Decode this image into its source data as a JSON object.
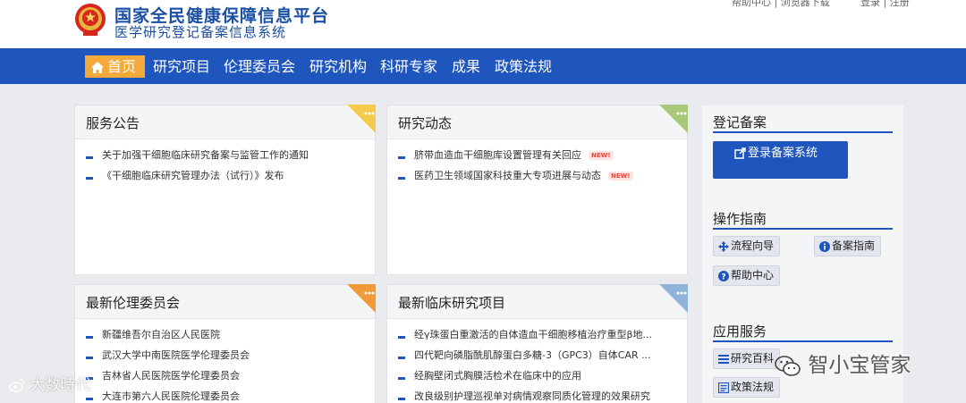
{
  "header": {
    "title_main": "国家全民健康保障信息平台",
    "title_sub": "医学研究登记备案信息系统",
    "top_link_left": "帮助中心 | 浏览器下载",
    "top_link_right": "登录 | 注册"
  },
  "nav": {
    "home": "首页",
    "items": [
      "研究项目",
      "伦理委员会",
      "研究机构",
      "科研专家",
      "成果",
      "政策法规"
    ]
  },
  "panels": {
    "notice": {
      "title": "服务公告",
      "items": [
        "关于加强干细胞临床研究备案与监管工作的通知",
        "《干细胞临床研究管理办法（试行）》发布"
      ]
    },
    "news": {
      "title": "研究动态",
      "items": [
        "脐带血造血干细胞库设置管理有关回应",
        "医药卫生领域国家科技重大专项进展与动态"
      ],
      "badge": "NEW!"
    },
    "ethics": {
      "title": "最新伦理委员会",
      "items": [
        "新疆维吾尔自治区人民医院",
        "武汉大学中南医院医学伦理委员会",
        "吉林省人民医院医学伦理委员会",
        "大连市第六人民医院伦理委员会"
      ]
    },
    "projects": {
      "title": "最新临床研究项目",
      "items": [
        "经γ珠蛋白重激活的自体造血干细胞移植治疗重型β地...",
        "四代靶向磷脂酰肌醇蛋白多糖-3（GPC3）自体CAR ...",
        "经胸壁闭式胸膜活检术在临床中的应用",
        "改良级别护理巡视单对病情观察同质化管理的效果研究"
      ]
    }
  },
  "sidebar": {
    "register_title": "登记备案",
    "register_button": "登录备案系统",
    "guide_title": "操作指南",
    "guide_flow": "流程向导",
    "guide_manual": "备案指南",
    "guide_help": "帮助中心",
    "apps_title": "应用服务",
    "app_encyclopedia": "研究百科",
    "app_policy": "政策法规"
  },
  "watermarks": {
    "left": "大数時代",
    "right": "智小宝管家"
  },
  "colors": {
    "brand_blue": "#1e56bd",
    "home_orange": "#f4a93a",
    "corner_yellow": "#f5c94a",
    "corner_green": "#a8c97a",
    "corner_orange": "#f09a3a",
    "corner_blue": "#8fb3d9"
  }
}
